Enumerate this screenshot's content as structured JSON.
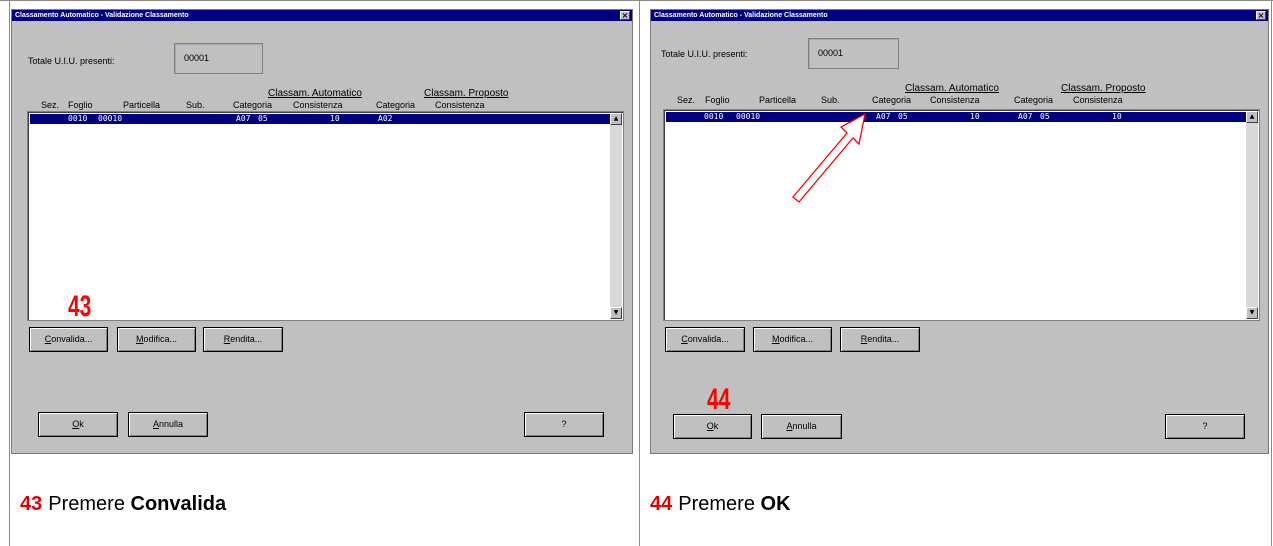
{
  "panels": [
    {
      "title": "Classamento Automatico - Validazione Classamento",
      "close_glyph": "×",
      "totale_label": "Totale U.I.U. presenti:",
      "totale_value": "00001",
      "group_auto": "Classam. Automatico",
      "group_prop": "Classam. Proposto",
      "headers": [
        "Sez.",
        "Foglio",
        "Particella",
        "Sub.",
        "Categoria",
        "Consistenza",
        "Categoria",
        "Consistenza"
      ],
      "row": [
        "0010",
        "00010",
        "A07",
        "05",
        "10",
        "A02",
        "",
        ""
      ],
      "scroll_up": "▲",
      "scroll_down": "▼",
      "buttons": {
        "convalida": {
          "ul": "C",
          "rest": "onvalida..."
        },
        "modifica": {
          "ul": "M",
          "rest": "odifica..."
        },
        "rendita": {
          "ul": "R",
          "rest": "endita..."
        },
        "ok": {
          "ul": "O",
          "rest": "k"
        },
        "annulla": {
          "ul": "A",
          "rest": "nnulla"
        },
        "help": "?"
      },
      "step_number": "43",
      "caption_number": "43",
      "caption_verb": "Premere",
      "caption_target": "Convalida"
    },
    {
      "title": "Classamento Automatico - Validazione Classamento",
      "close_glyph": "×",
      "totale_label": "Totale U.I.U. presenti:",
      "totale_value": "00001",
      "group_auto": "Classam. Automatico",
      "group_prop": "Classam. Proposto",
      "headers": [
        "Sez.",
        "Foglio",
        "Particella",
        "Sub.",
        "Categoria",
        "Consistenza",
        "Categoria",
        "Consistenza"
      ],
      "row": [
        "0010",
        "00010",
        "A07",
        "05",
        "10",
        "A07",
        "05",
        "10"
      ],
      "scroll_up": "▲",
      "scroll_down": "▼",
      "buttons": {
        "convalida": {
          "ul": "C",
          "rest": "onvalida..."
        },
        "modifica": {
          "ul": "M",
          "rest": "odifica..."
        },
        "rendita": {
          "ul": "R",
          "rest": "endita..."
        },
        "ok": {
          "ul": "O",
          "rest": "k"
        },
        "annulla": {
          "ul": "A",
          "rest": "nnulla"
        },
        "help": "?"
      },
      "step_number": "44",
      "caption_number": "44",
      "caption_verb": "Premere",
      "caption_target": "OK"
    }
  ],
  "colors": {
    "title_bar": "#000080",
    "selected_row": "#000080",
    "dialog_bg": "#c0c0c0",
    "step_number": "#ff0000"
  }
}
